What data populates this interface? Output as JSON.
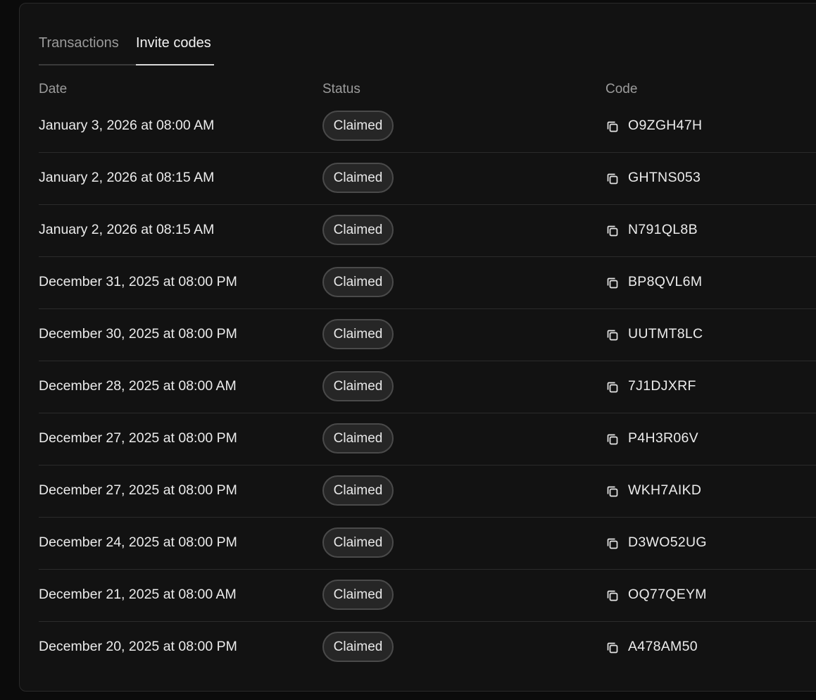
{
  "tabs": [
    {
      "label": "Transactions",
      "active": false
    },
    {
      "label": "Invite codes",
      "active": true
    }
  ],
  "table": {
    "columns": [
      "Date",
      "Status",
      "Code"
    ],
    "rows": [
      {
        "date": "January 3, 2026 at 08:00 AM",
        "status": "Claimed",
        "code": "O9ZGH47H"
      },
      {
        "date": "January 2, 2026 at 08:15 AM",
        "status": "Claimed",
        "code": "GHTNS053"
      },
      {
        "date": "January 2, 2026 at 08:15 AM",
        "status": "Claimed",
        "code": "N791QL8B"
      },
      {
        "date": "December 31, 2025 at 08:00 PM",
        "status": "Claimed",
        "code": "BP8QVL6M"
      },
      {
        "date": "December 30, 2025 at 08:00 PM",
        "status": "Claimed",
        "code": "UUTMT8LC"
      },
      {
        "date": "December 28, 2025 at 08:00 AM",
        "status": "Claimed",
        "code": "7J1DJXRF"
      },
      {
        "date": "December 27, 2025 at 08:00 PM",
        "status": "Claimed",
        "code": "P4H3R06V"
      },
      {
        "date": "December 27, 2025 at 08:00 PM",
        "status": "Claimed",
        "code": "WKH7AIKD"
      },
      {
        "date": "December 24, 2025 at 08:00 PM",
        "status": "Claimed",
        "code": "D3WO52UG"
      },
      {
        "date": "December 21, 2025 at 08:00 AM",
        "status": "Claimed",
        "code": "OQ77QEYM"
      },
      {
        "date": "December 20, 2025 at 08:00 PM",
        "status": "Claimed",
        "code": "A478AM50"
      }
    ]
  },
  "icons": {
    "copy": "copy-icon"
  },
  "colors": {
    "background": "#0b0b0b",
    "card": "#121212",
    "badge_bg": "#262626",
    "badge_border": "#4a4a4a",
    "text": "#ececec",
    "muted": "#9c9c9c"
  }
}
